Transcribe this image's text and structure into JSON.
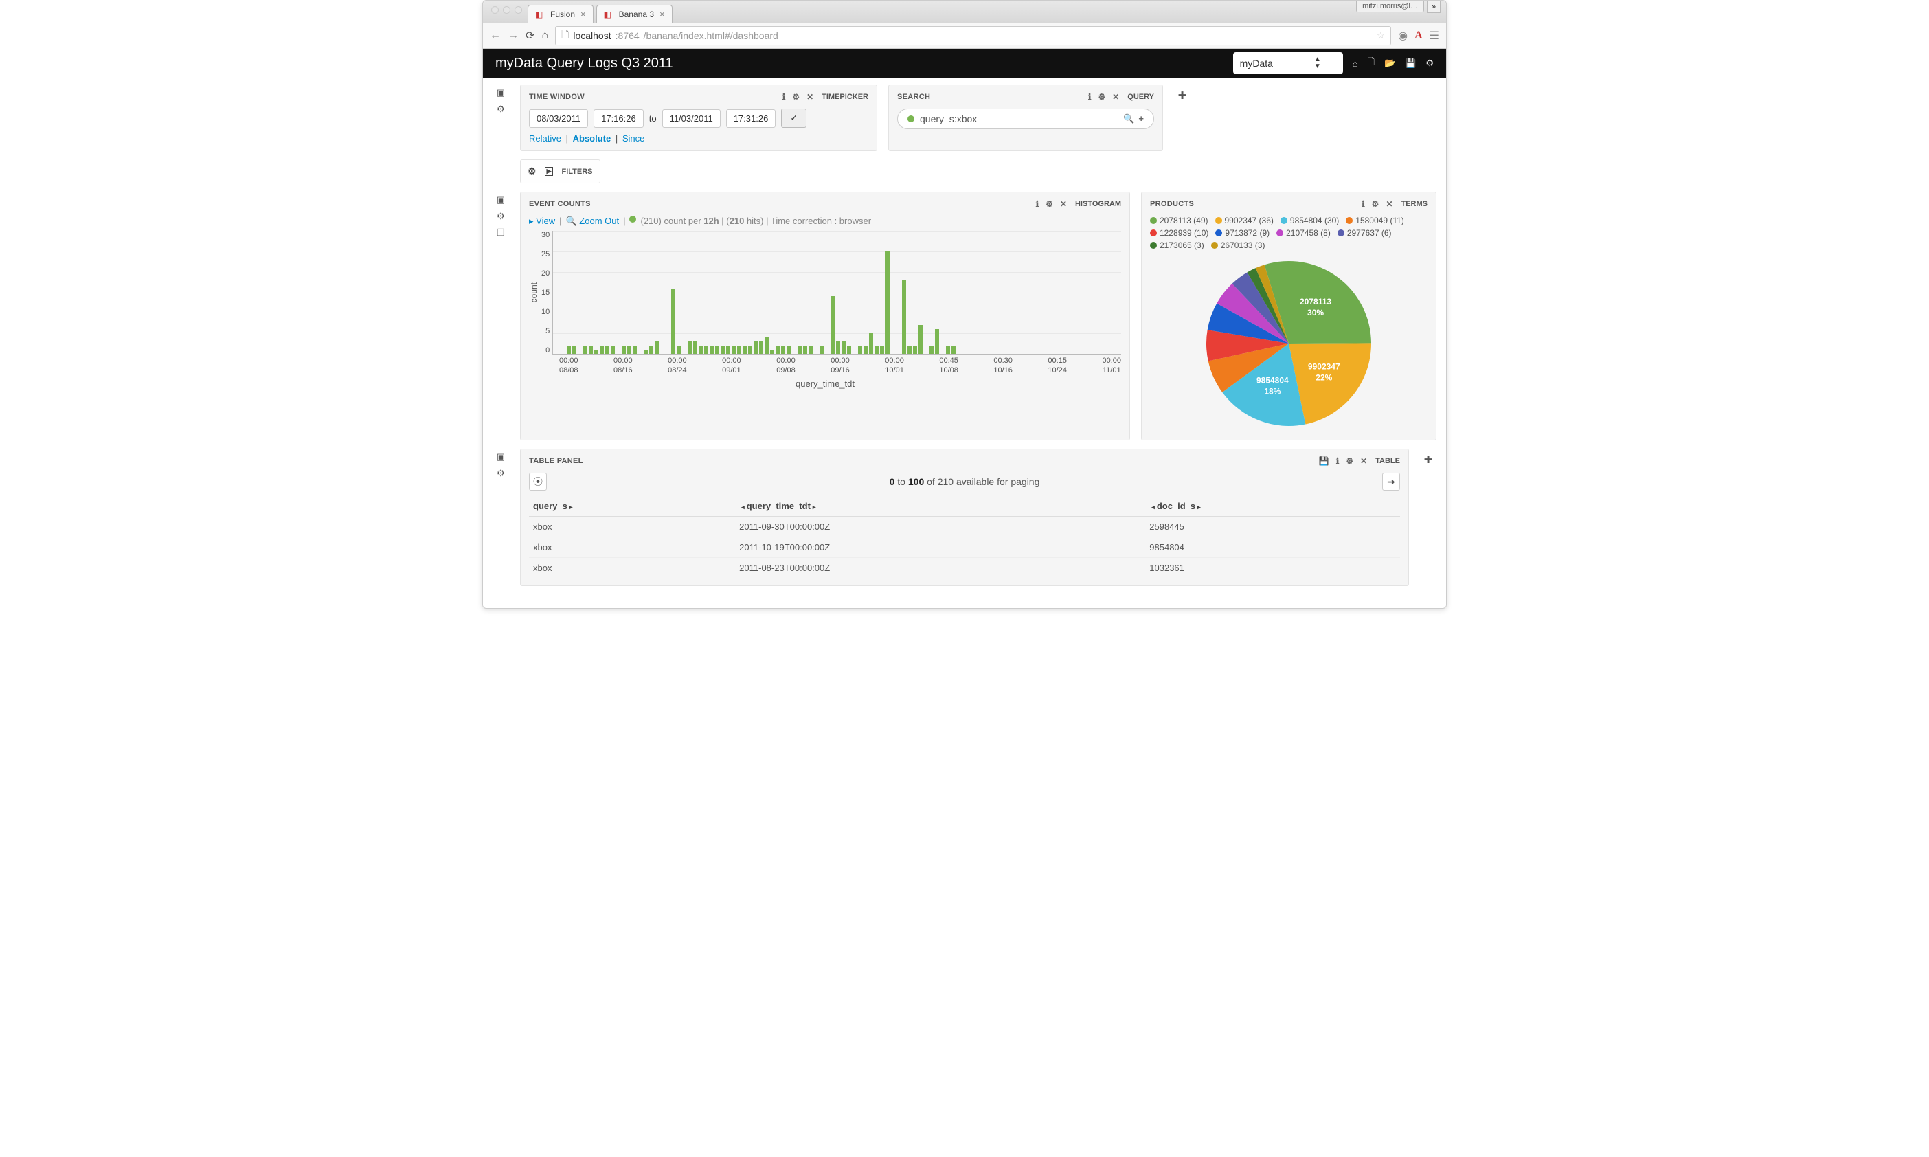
{
  "browser": {
    "tabs": [
      {
        "title": "Fusion",
        "active": false
      },
      {
        "title": "Banana 3",
        "active": true
      }
    ],
    "user_label": "mitzi.morris@l…",
    "url_host": "localhost",
    "url_port": ":8764",
    "url_path": "/banana/index.html#/dashboard"
  },
  "header": {
    "title": "myData Query Logs Q3 2011",
    "collection": "myData"
  },
  "timepicker": {
    "panel_title": "TIME WINDOW",
    "panel_type": "TIMEPICKER",
    "from_date": "08/03/2011",
    "from_time": "17:16:26",
    "to_label": "to",
    "to_date": "11/03/2011",
    "to_time": "17:31:26",
    "mode_relative": "Relative",
    "mode_absolute": "Absolute",
    "mode_since": "Since"
  },
  "search": {
    "panel_title": "SEARCH",
    "panel_type": "QUERY",
    "query": "query_s:xbox"
  },
  "filters": {
    "label": "FILTERS"
  },
  "histogram": {
    "panel_title": "EVENT COUNTS",
    "panel_type": "HISTOGRAM",
    "view_label": "View",
    "zoom_label": "Zoom Out",
    "summary_prefix": "(210)  count per",
    "summary_interval": "12h",
    "summary_hits": "210",
    "summary_hits_suffix": " hits) | Time correction : browser",
    "ylabel": "count",
    "xlabel": "query_time_tdt",
    "yticks": [
      "30",
      "25",
      "20",
      "15",
      "10",
      "5",
      "0"
    ],
    "xtick_times": [
      "00:00",
      "00:00",
      "00:00",
      "00:00",
      "00:00",
      "00:00",
      "00:00",
      "00:45",
      "00:30",
      "00:15",
      "00:00"
    ],
    "xtick_dates": [
      "08/08",
      "08/16",
      "08/24",
      "09/01",
      "09/08",
      "09/16",
      "10/01",
      "10/08",
      "10/16",
      "10/24",
      "11/01"
    ]
  },
  "products": {
    "panel_title": "PRODUCTS",
    "panel_type": "TERMS",
    "items": [
      {
        "id": "2078113",
        "count": 49,
        "pct": 30,
        "color": "#6eab4c"
      },
      {
        "id": "9902347",
        "count": 36,
        "pct": 22,
        "color": "#f0ad24"
      },
      {
        "id": "9854804",
        "count": 30,
        "pct": 18,
        "color": "#4bc0de"
      },
      {
        "id": "1580049",
        "count": 11,
        "pct": 7,
        "color": "#ef7b1d"
      },
      {
        "id": "1228939",
        "count": 10,
        "pct": 6,
        "color": "#e83e36"
      },
      {
        "id": "9713872",
        "count": 9,
        "pct": 5,
        "color": "#1a5fcf"
      },
      {
        "id": "2107458",
        "count": 8,
        "pct": 5,
        "color": "#c047c8"
      },
      {
        "id": "2977637",
        "count": 6,
        "pct": 3,
        "color": "#5a5faf"
      },
      {
        "id": "2173065",
        "count": 3,
        "pct": 2,
        "color": "#3c7a2f"
      },
      {
        "id": "2670133",
        "count": 3,
        "pct": 2,
        "color": "#c79a17"
      }
    ]
  },
  "table": {
    "panel_title": "TABLE PANEL",
    "panel_type": "TABLE",
    "pager_from": "0",
    "pager_to": "100",
    "pager_total": "210",
    "pager_mid": " of ",
    "pager_suffix": " available for paging",
    "pager_to_label": " to ",
    "columns": [
      "query_s",
      "query_time_tdt",
      "doc_id_s"
    ],
    "rows": [
      {
        "query_s": "xbox",
        "query_time_tdt": "2011-09-30T00:00:00Z",
        "doc_id_s": "2598445"
      },
      {
        "query_s": "xbox",
        "query_time_tdt": "2011-10-19T00:00:00Z",
        "doc_id_s": "9854804"
      },
      {
        "query_s": "xbox",
        "query_time_tdt": "2011-08-23T00:00:00Z",
        "doc_id_s": "1032361"
      }
    ]
  },
  "chart_data": {
    "histogram": {
      "type": "bar",
      "title": "EVENT COUNTS",
      "xlabel": "query_time_tdt",
      "ylabel": "count",
      "ylim": [
        0,
        30
      ],
      "interval": "12h",
      "total_hits": 210,
      "values": [
        0,
        0,
        2,
        2,
        0,
        2,
        2,
        1,
        2,
        2,
        2,
        0,
        2,
        2,
        2,
        0,
        1,
        2,
        3,
        0,
        0,
        16,
        2,
        0,
        3,
        3,
        2,
        2,
        2,
        2,
        2,
        2,
        2,
        2,
        2,
        2,
        3,
        3,
        4,
        1,
        2,
        2,
        2,
        0,
        2,
        2,
        2,
        0,
        2,
        0,
        14,
        3,
        3,
        2,
        0,
        2,
        2,
        5,
        2,
        2,
        25,
        0,
        0,
        18,
        2,
        2,
        7,
        0,
        2,
        6,
        0,
        2,
        2,
        0
      ]
    },
    "pie": {
      "type": "pie",
      "title": "PRODUCTS",
      "categories": [
        "2078113",
        "9902347",
        "9854804",
        "1580049",
        "1228939",
        "9713872",
        "2107458",
        "2977637",
        "2173065",
        "2670133"
      ],
      "values": [
        49,
        36,
        30,
        11,
        10,
        9,
        8,
        6,
        3,
        3
      ]
    }
  }
}
